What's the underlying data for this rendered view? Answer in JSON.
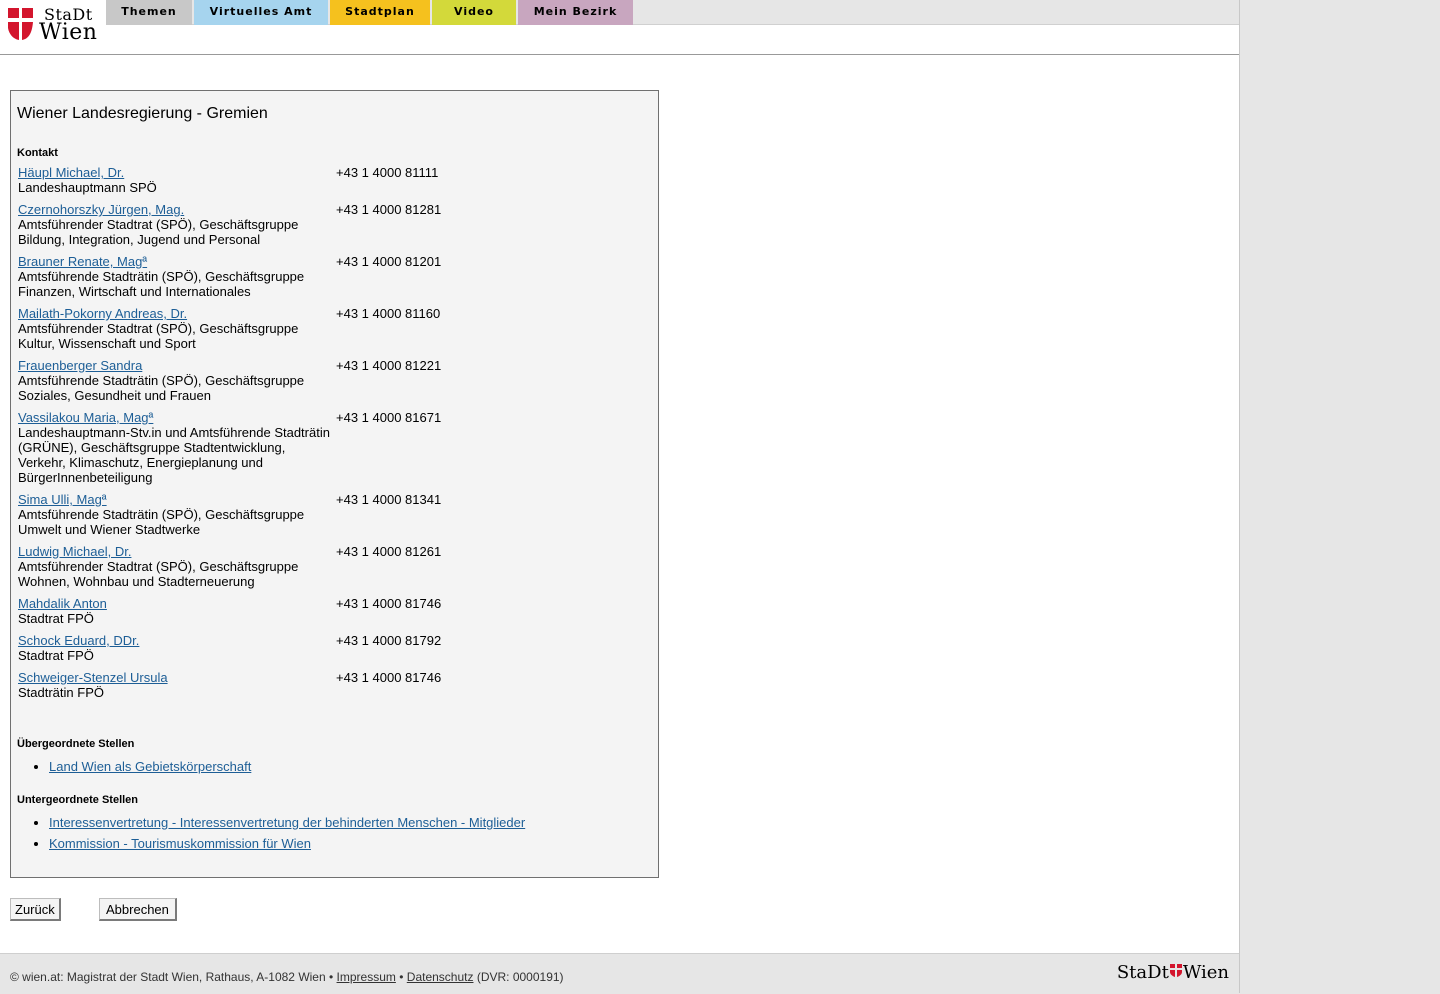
{
  "header": {
    "logo_top": "StaDt",
    "logo_bottom": "Wien",
    "tabs": [
      {
        "label": "Themen",
        "color": "#c8c8c8"
      },
      {
        "label": "Virtuelles Amt",
        "color": "#a6d4ee"
      },
      {
        "label": "Stadtplan",
        "color": "#f5c11e"
      },
      {
        "label": "Video",
        "color": "#d3d93a"
      },
      {
        "label": "Mein Bezirk",
        "color": "#c8a6bf"
      }
    ]
  },
  "main": {
    "title": "Wiener Landesregierung - Gremien",
    "contact_heading": "Kontakt",
    "contacts": [
      {
        "name": "Häupl Michael, Dr.",
        "role": "Landeshauptmann SPÖ",
        "phone": "+43 1 4000 81111"
      },
      {
        "name": "Czernohorszky Jürgen, Mag.",
        "role": "Amtsführender Stadtrat (SPÖ), Geschäftsgruppe Bildung, Integration, Jugend und Personal",
        "phone": "+43 1 4000 81281"
      },
      {
        "name": "Brauner Renate, Magª",
        "role": "Amtsführende Stadträtin (SPÖ), Geschäftsgruppe Finanzen, Wirtschaft und Internationales",
        "phone": "+43 1 4000 81201"
      },
      {
        "name": "Mailath-Pokorny Andreas, Dr.",
        "role": "Amtsführender Stadtrat (SPÖ), Geschäftsgruppe Kultur, Wissenschaft und Sport",
        "phone": "+43 1 4000 81160"
      },
      {
        "name": "Frauenberger Sandra",
        "role": "Amtsführende Stadträtin (SPÖ), Geschäftsgruppe Soziales, Gesundheit und Frauen",
        "phone": "+43 1 4000 81221"
      },
      {
        "name": "Vassilakou Maria, Magª",
        "role": "Landeshauptmann-Stv.in und Amtsführende Stadträtin (GRÜNE), Geschäftsgruppe Stadtentwicklung, Verkehr, Klimaschutz, Energieplanung und BürgerInnenbeteiligung",
        "phone": "+43 1 4000 81671"
      },
      {
        "name": "Sima Ulli, Magª",
        "role": "Amtsführende Stadträtin (SPÖ), Geschäftsgruppe Umwelt und Wiener Stadtwerke",
        "phone": "+43 1 4000 81341"
      },
      {
        "name": "Ludwig Michael, Dr.",
        "role": "Amtsführender Stadtrat (SPÖ), Geschäftsgruppe Wohnen, Wohnbau und Stadterneuerung",
        "phone": "+43 1 4000 81261"
      },
      {
        "name": "Mahdalik Anton",
        "role": "Stadtrat FPÖ",
        "phone": "+43 1 4000 81746"
      },
      {
        "name": "Schock Eduard, DDr.",
        "role": "Stadtrat FPÖ",
        "phone": "+43 1 4000 81792"
      },
      {
        "name": "Schweiger-Stenzel Ursula",
        "role": "Stadträtin FPÖ",
        "phone": "+43 1 4000 81746"
      }
    ],
    "parent_heading": "Übergeordnete Stellen",
    "parent_links": [
      "Land Wien als Gebietskörperschaft"
    ],
    "child_heading": "Untergeordnete Stellen",
    "child_links": [
      "Interessenvertretung - Interessenvertretung der behinderten Menschen - Mitglieder",
      "Kommission - Tourismuskommission für Wien"
    ]
  },
  "buttons": {
    "back": "Zurück",
    "cancel": "Abbrechen"
  },
  "footer": {
    "copyright": "© wien.at: Magistrat der Stadt Wien, Rathaus, A-1082 Wien •",
    "impressum": "Impressum",
    "separator": "•",
    "datenschutz": "Datenschutz",
    "dvr": "(DVR: 0000191)",
    "logo_text": "StaDt",
    "logo_text2": "Wien"
  },
  "colors": {
    "link": "#1d5e96",
    "flag_red": "#d3152d"
  }
}
